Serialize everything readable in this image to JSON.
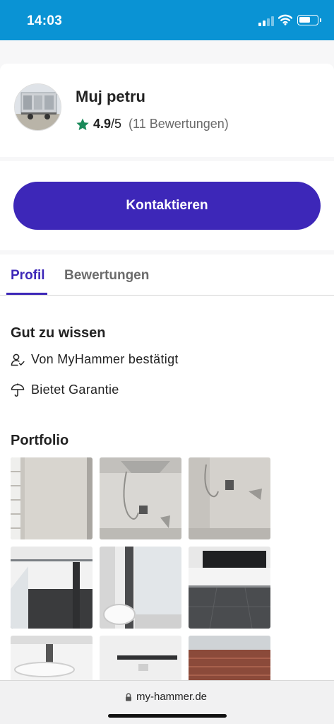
{
  "status_bar": {
    "time": "14:03",
    "icons": [
      "signal-icon",
      "wifi-icon",
      "battery-icon"
    ]
  },
  "profile": {
    "name": "Muj petru",
    "rating_value": "4.9",
    "rating_max": "/5",
    "rating_count": "(11 Bewertungen)",
    "star_color": "#1a8a5a"
  },
  "cta": {
    "contact_label": "Kontaktieren",
    "color": "#3d27b8"
  },
  "tabs": [
    {
      "label": "Profil",
      "active": true
    },
    {
      "label": "Bewertungen",
      "active": false
    }
  ],
  "good_to_know": {
    "title": "Gut zu wissen",
    "items": [
      {
        "icon": "verified-user-icon",
        "label": "Von MyHammer bestätigt"
      },
      {
        "icon": "umbrella-icon",
        "label": "Bietet Garantie"
      }
    ]
  },
  "portfolio": {
    "title": "Portfolio",
    "images": [
      "bathroom-photo-1",
      "bathroom-photo-2",
      "bathroom-photo-3",
      "bathroom-photo-4",
      "bathroom-photo-5",
      "bathroom-photo-6",
      "bathroom-photo-7",
      "bathroom-photo-8",
      "bathroom-photo-9"
    ]
  },
  "browser": {
    "url": "my-hammer.de"
  }
}
